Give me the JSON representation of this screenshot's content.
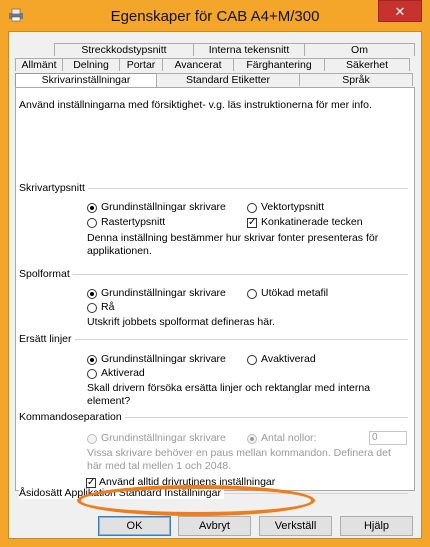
{
  "window": {
    "title": "Egenskaper för CAB A4+M/300",
    "close_symbol": "✕",
    "frame_color": "#f4a62a"
  },
  "tabs": {
    "row1": [
      "Streckkodstypsnitt",
      "Interna tekensnitt",
      "Om"
    ],
    "row2": [
      "Allmänt",
      "Delning",
      "Portar",
      "Avancerat",
      "Färghantering",
      "Säkerhet"
    ],
    "row3": [
      "Skrivarinställningar",
      "Standard Etiketter",
      "Språk"
    ],
    "active": "Skrivarinställningar"
  },
  "intro": "Använd inställningarna med försiktighet- v.g. läs instruktionerna för mer info.",
  "skrivartypsnitt": {
    "label": "Skrivartypsnitt",
    "opt_default": "Grundinställningar skrivare",
    "opt_vector": "Vektortypsnitt",
    "opt_raster": "Rastertypsnitt",
    "concat": "Konkatinerade tecken",
    "desc": "Denna inställning bestämmer hur skrivar fonter presenteras för applikationen."
  },
  "spolformat": {
    "label": "Spolformat",
    "opt_default": "Grundinställningar skrivare",
    "opt_emf": "Utökad metafil",
    "opt_raw": "Rå",
    "desc": "Utskrift jobbets spolformat defineras här."
  },
  "ersatt": {
    "label": "Ersätt linjer",
    "opt_default": "Grundinställningar skrivare",
    "opt_off": "Avaktiverad",
    "opt_on": "Aktiverad",
    "desc": "Skall drivern försöka ersätta linjer och rektanglar med interna element?"
  },
  "kommando": {
    "label": "Kommandoseparation",
    "opt_default": "Grundinställningar skrivare",
    "opt_count": "Antal nollor:",
    "count_value": "0",
    "desc": "Vissa skrivare behöver en paus mellan kommandon. Definera det här med tal mellen 1 och 2048."
  },
  "asidosatt": {
    "label": "Åsidosätt Applikation Standard Inställningar",
    "check_label": "Använd alltid drivrutinens inställningar"
  },
  "buttons": {
    "ok": "OK",
    "cancel": "Avbryt",
    "apply": "Verkställ",
    "help": "Hjälp"
  },
  "highlight_color": "#ee7d1e"
}
